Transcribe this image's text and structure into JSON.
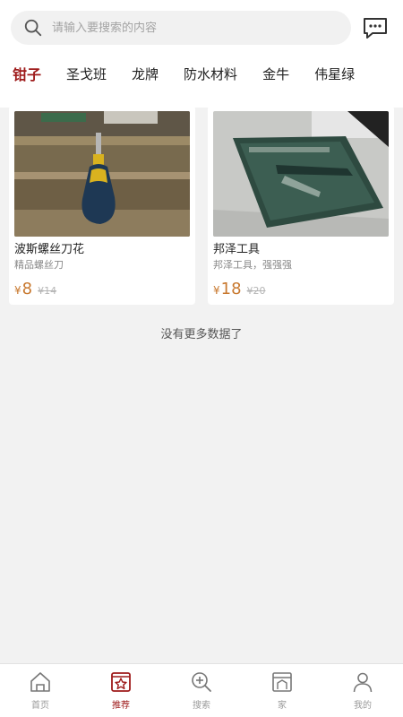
{
  "search": {
    "placeholder": "请输入要搜索的内容"
  },
  "tabs": [
    {
      "label": "钳子",
      "active": true
    },
    {
      "label": "圣戈班"
    },
    {
      "label": "龙牌"
    },
    {
      "label": "防水材料"
    },
    {
      "label": "金牛"
    },
    {
      "label": "伟星绿"
    }
  ],
  "products": [
    {
      "name": "波斯螺丝刀花",
      "desc": "精品螺丝刀",
      "currency": "¥",
      "price": "8",
      "old_price": "¥14"
    },
    {
      "name": "邦泽工具",
      "desc": "邦泽工具，强强强",
      "currency": "¥",
      "price": "18",
      "old_price": "¥20"
    }
  ],
  "status": {
    "no_more": "没有更多数据了"
  },
  "bottom_nav": [
    {
      "label": "首页",
      "icon": "home-icon"
    },
    {
      "label": "推荐",
      "icon": "star-icon",
      "active": true
    },
    {
      "label": "搜索",
      "icon": "search-zoom-icon"
    },
    {
      "label": "家",
      "icon": "house-window-icon"
    },
    {
      "label": "我的",
      "icon": "user-icon"
    }
  ],
  "colors": {
    "accent": "#9e1a1a",
    "price": "#c8782e"
  }
}
